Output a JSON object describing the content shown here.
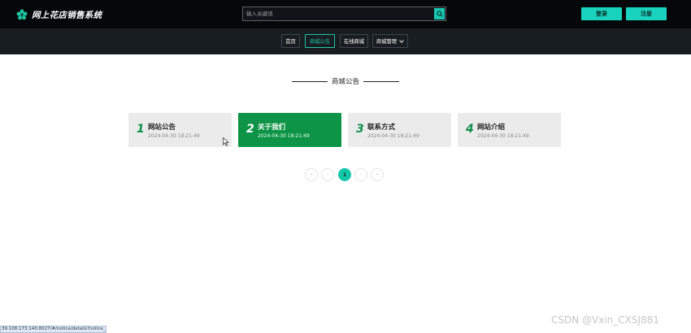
{
  "header": {
    "logo_text": "网上花店销售系统",
    "search_placeholder": "输入关键词",
    "login_label": "登录",
    "register_label": "注册"
  },
  "nav": {
    "items": [
      {
        "label": "首页"
      },
      {
        "label": "商城公告"
      },
      {
        "label": "在线商城"
      },
      {
        "label": "商城管理"
      }
    ],
    "active": "商城公告"
  },
  "section": {
    "title": "商城公告"
  },
  "cards": [
    {
      "num": "1",
      "title": "网站公告",
      "date": "2024-04-30 18:21:49"
    },
    {
      "num": "2",
      "title": "关于我们",
      "date": "2024-04-30 18:21:49"
    },
    {
      "num": "3",
      "title": "联系方式",
      "date": "2024-04-30 18:21:49"
    },
    {
      "num": "4",
      "title": "网站介绍",
      "date": "2024-04-30 18:21:49"
    }
  ],
  "pagination": {
    "first": "«",
    "prev": "‹",
    "current": "1",
    "next": "›",
    "last": "»"
  },
  "statusbar": {
    "url": "39.108.173.140:8027/#/notice/details?notice_id=2"
  },
  "watermark": {
    "text": "CSDN @Vxin_CXSJ881"
  },
  "colors": {
    "header_bg": "#05080b",
    "nav_bg": "#181d22",
    "accent": "#19d3bf",
    "card_active": "#0d9446",
    "card_number": "#0d8f48"
  }
}
